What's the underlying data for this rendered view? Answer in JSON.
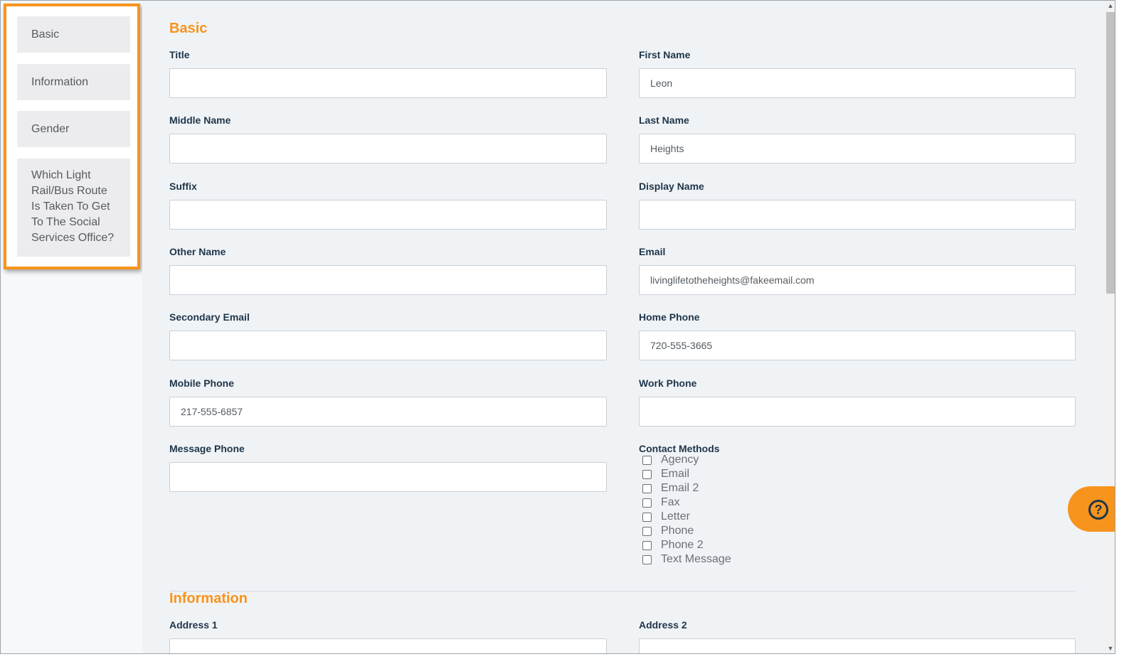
{
  "sidebar": {
    "items": [
      {
        "label": "Basic"
      },
      {
        "label": "Information"
      },
      {
        "label": "Gender"
      },
      {
        "label": "Which Light Rail/Bus Route Is Taken To Get To The Social Services Office?"
      }
    ]
  },
  "sections": {
    "basic": {
      "title": "Basic"
    },
    "information": {
      "title": "Information"
    }
  },
  "fields": {
    "title": {
      "label": "Title",
      "value": ""
    },
    "first_name": {
      "label": "First Name",
      "value": "Leon"
    },
    "middle_name": {
      "label": "Middle Name",
      "value": ""
    },
    "last_name": {
      "label": "Last Name",
      "value": "Heights"
    },
    "suffix": {
      "label": "Suffix",
      "value": ""
    },
    "display_name": {
      "label": "Display Name",
      "value": ""
    },
    "other_name": {
      "label": "Other Name",
      "value": ""
    },
    "email": {
      "label": "Email",
      "value": "livinglifetotheheights@fakeemail.com"
    },
    "secondary_email": {
      "label": "Secondary Email",
      "value": ""
    },
    "home_phone": {
      "label": "Home Phone",
      "value": "720-555-3665"
    },
    "mobile_phone": {
      "label": "Mobile Phone",
      "value": "217-555-6857"
    },
    "work_phone": {
      "label": "Work Phone",
      "value": ""
    },
    "message_phone": {
      "label": "Message Phone",
      "value": ""
    },
    "address1": {
      "label": "Address 1",
      "value": ""
    },
    "address2": {
      "label": "Address 2",
      "value": ""
    }
  },
  "contact_methods": {
    "label": "Contact Methods",
    "options": [
      {
        "label": "Agency",
        "checked": false
      },
      {
        "label": "Email",
        "checked": false
      },
      {
        "label": "Email 2",
        "checked": false
      },
      {
        "label": "Fax",
        "checked": false
      },
      {
        "label": "Letter",
        "checked": false
      },
      {
        "label": "Phone",
        "checked": false
      },
      {
        "label": "Phone 2",
        "checked": false
      },
      {
        "label": "Text Message",
        "checked": false
      }
    ]
  },
  "help": {
    "icon": "question-circle-icon"
  },
  "colors": {
    "accent": "#f7941d",
    "label": "#1e3549",
    "background": "#f0f3f6"
  }
}
